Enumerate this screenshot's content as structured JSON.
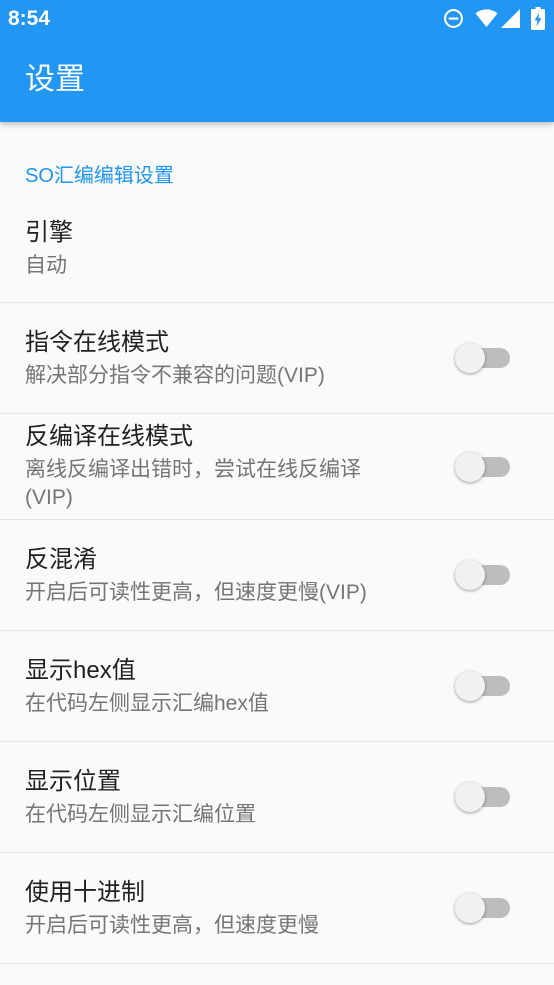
{
  "status_bar": {
    "time": "8:54",
    "icons": [
      "do-not-disturb-icon",
      "wifi-icon",
      "cell-signal-icon",
      "battery-charging-icon"
    ]
  },
  "app_bar": {
    "title": "设置"
  },
  "section": {
    "header": "SO汇编编辑设置",
    "items": [
      {
        "title": "引擎",
        "summary": "自动"
      },
      {
        "title": "指令在线模式",
        "summary": "解决部分指令不兼容的问题(VIP)",
        "switch_on": false
      },
      {
        "title": "反编译在线模式",
        "summary": "离线反编译出错时，尝试在线反编译(VIP)",
        "switch_on": false
      },
      {
        "title": "反混淆",
        "summary": "开启后可读性更高，但速度更慢(VIP)",
        "switch_on": false
      },
      {
        "title": "显示hex值",
        "summary": "在代码左侧显示汇编hex值",
        "switch_on": false
      },
      {
        "title": "显示位置",
        "summary": "在代码左侧显示汇编位置",
        "switch_on": false
      },
      {
        "title": "使用十进制",
        "summary": "开启后可读性更高，但速度更慢",
        "switch_on": false
      }
    ]
  },
  "colors": {
    "primary": "#2196F3",
    "accent": "#2196F3",
    "background": "#FAFAFA",
    "title_text": "#212121",
    "summary_text": "#757575",
    "divider": "#E6E6E6",
    "switch_track_off": "#BDBDBD",
    "switch_thumb_off": "#F1F1F1"
  }
}
